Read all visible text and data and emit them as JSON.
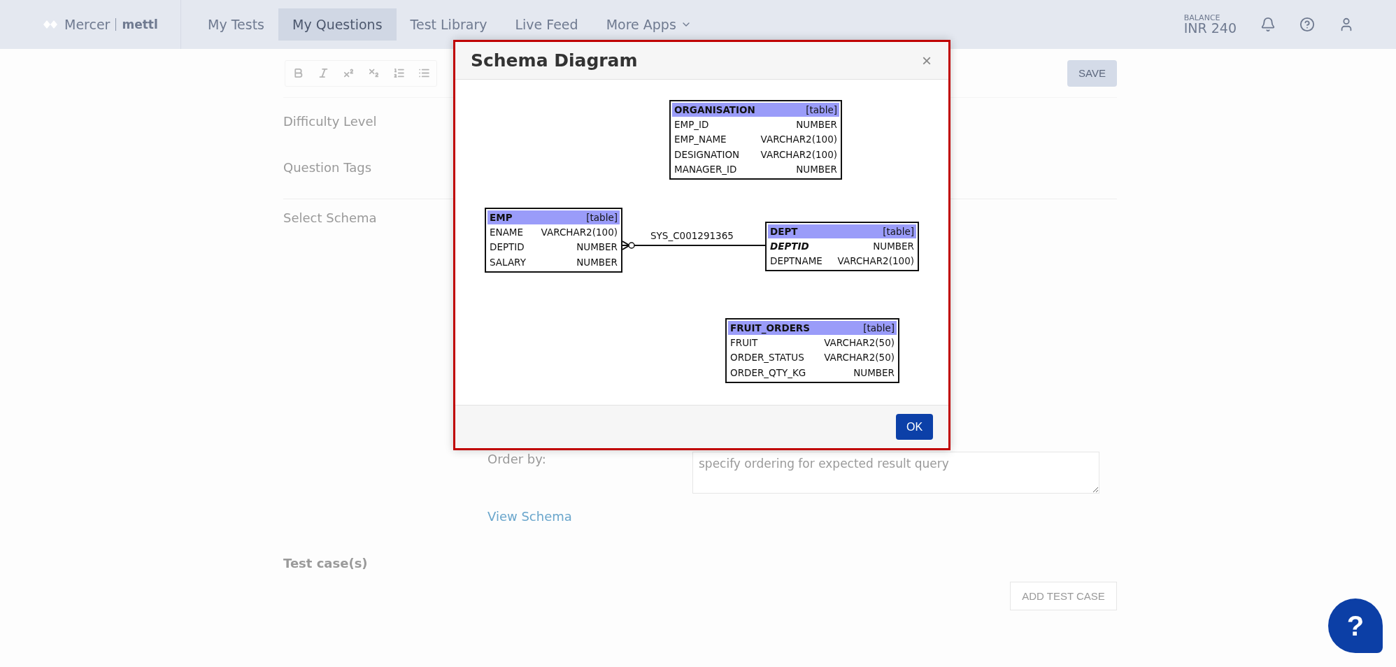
{
  "header": {
    "logo": {
      "brand": "Mercer",
      "product": "mettl"
    },
    "nav": [
      {
        "label": "My Tests",
        "selected": false
      },
      {
        "label": "My Questions",
        "selected": true
      },
      {
        "label": "Test Library",
        "selected": false
      },
      {
        "label": "Live Feed",
        "selected": false
      },
      {
        "label": "More Apps",
        "selected": false,
        "kind": "dropdown"
      }
    ],
    "balance": {
      "label": "BALANCE",
      "value": "INR 240"
    }
  },
  "editor": {
    "save_button": "SAVE"
  },
  "form": {
    "labels": [
      "Difficulty Level",
      "Question Tags"
    ],
    "schema_label": "Select Schema",
    "order_by": {
      "label": "Order by:",
      "placeholder": "specify ordering for expected result query"
    },
    "view_schema_link": "View Schema",
    "test_cases_heading": "Test case(s)",
    "add_test_case_button": "ADD TEST CASE"
  },
  "modal": {
    "title": "Schema Diagram",
    "close": "×",
    "ok_button": "OK",
    "tables": [
      {
        "name": "ORGANISATION",
        "tag": "[table]",
        "columns": [
          {
            "name": "EMP_ID",
            "type": "NUMBER",
            "primary_key": false
          },
          {
            "name": "EMP_NAME",
            "type": "VARCHAR2(100)",
            "primary_key": false
          },
          {
            "name": "DESIGNATION",
            "type": "VARCHAR2(100)",
            "primary_key": false
          },
          {
            "name": "MANAGER_ID",
            "type": "NUMBER",
            "primary_key": false
          }
        ]
      },
      {
        "name": "EMP",
        "tag": "[table]",
        "columns": [
          {
            "name": "ENAME",
            "type": "VARCHAR2(100)",
            "primary_key": false
          },
          {
            "name": "DEPTID",
            "type": "NUMBER",
            "primary_key": false
          },
          {
            "name": "SALARY",
            "type": "NUMBER",
            "primary_key": false
          }
        ]
      },
      {
        "name": "DEPT",
        "tag": "[table]",
        "columns": [
          {
            "name": "DEPTID",
            "type": "NUMBER",
            "primary_key": true
          },
          {
            "name": "DEPTNAME",
            "type": "VARCHAR2(100)",
            "primary_key": false
          }
        ]
      },
      {
        "name": "FRUIT_ORDERS",
        "tag": "[table]",
        "columns": [
          {
            "name": "FRUIT",
            "type": "VARCHAR2(50)",
            "primary_key": false
          },
          {
            "name": "ORDER_STATUS",
            "type": "VARCHAR2(50)",
            "primary_key": false
          },
          {
            "name": "ORDER_QTY_KG",
            "type": "NUMBER",
            "primary_key": false
          }
        ]
      }
    ],
    "relations": [
      {
        "label": "SYS_C001291365"
      }
    ]
  },
  "help_button": "?"
}
